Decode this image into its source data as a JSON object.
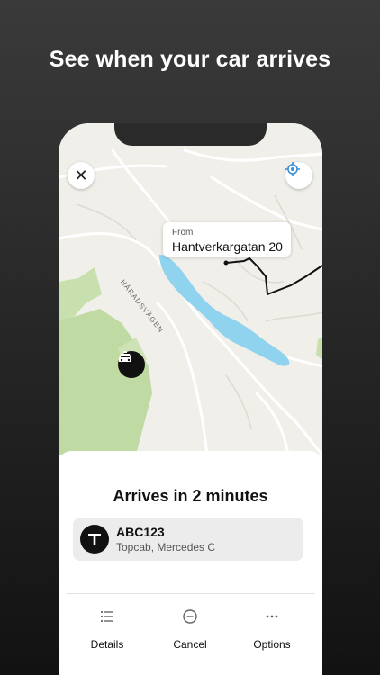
{
  "headline": "See when your car arrives",
  "map": {
    "from_label": "From",
    "from_address": "Hantverkargatan 20",
    "street_name": "HÄRADSVÄGEN",
    "close_icon": "close-icon",
    "locate_icon": "locate-icon",
    "taxi_icon": "taxi-icon"
  },
  "trip": {
    "arrival_text": "Arrives in 2 minutes",
    "plate": "ABC123",
    "car_description": "Topcab, Mercedes C",
    "company_logo": "T"
  },
  "actions": [
    {
      "label": "Details",
      "icon": "list-icon"
    },
    {
      "label": "Cancel",
      "icon": "cancel-icon"
    },
    {
      "label": "Options",
      "icon": "more-icon"
    }
  ],
  "colors": {
    "map_background": "#f1efe9",
    "water": "#8fd3ee",
    "park": "#c8dfae",
    "route": "#111111",
    "accent_blue": "#3a8fd6"
  }
}
